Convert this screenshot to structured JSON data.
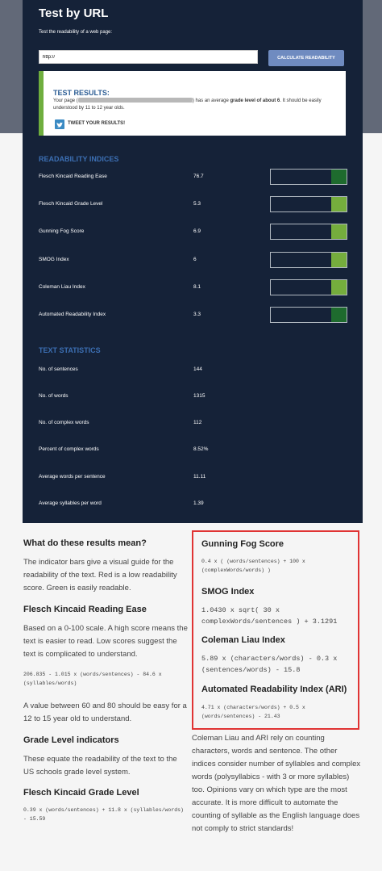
{
  "header": {
    "title": "Test by URL",
    "subtitle": "Test the readability of a web page:"
  },
  "url_input": {
    "value": "http://"
  },
  "calc_button": "CALCULATE READABILITY",
  "results": {
    "title": "TEST RESULTS:",
    "text_prefix": "Your page (",
    "text_mid": ") has an average ",
    "text_bold": "grade level of about 6",
    "text_suffix": ". It should be easily understood by 11 to 12 year olds.",
    "tweet": "TWEET YOUR RESULTS!"
  },
  "indices": {
    "heading": "READABILITY INDICES",
    "rows": [
      {
        "label": "Flesch Kincaid Reading Ease",
        "value": "76.7",
        "fill": 0.2,
        "color": "#1e6b2e"
      },
      {
        "label": "Flesch Kincaid Grade Level",
        "value": "5.3",
        "fill": 0.2,
        "color": "#75ad3d"
      },
      {
        "label": "Gunning Fog Score",
        "value": "6.9",
        "fill": 0.2,
        "color": "#75ad3d"
      },
      {
        "label": "SMOG Index",
        "value": "6",
        "fill": 0.2,
        "color": "#75ad3d"
      },
      {
        "label": "Coleman Liau Index",
        "value": "8.1",
        "fill": 0.2,
        "color": "#75ad3d"
      },
      {
        "label": "Automated Readability Index",
        "value": "3.3",
        "fill": 0.2,
        "color": "#1e6b2e"
      }
    ]
  },
  "stats": {
    "heading": "TEXT STATISTICS",
    "rows": [
      {
        "label": "No. of sentences",
        "value": "144"
      },
      {
        "label": "No. of words",
        "value": "1315"
      },
      {
        "label": "No. of complex words",
        "value": "112"
      },
      {
        "label": "Percent of complex words",
        "value": "8.52%"
      },
      {
        "label": "Average words per sentence",
        "value": "11.11"
      },
      {
        "label": "Average syllables per word",
        "value": "1.39"
      }
    ]
  },
  "left": {
    "h1": "What do these results mean?",
    "p1": "The indicator bars give a visual guide for the readability of the text. Red is a low readability score. Green is easily readable.",
    "h2": "Flesch Kincaid Reading Ease",
    "p2": "Based on a 0-100 scale. A high score means the text is easier to read. Low scores suggest the text is complicated to understand.",
    "f2": "206.835 - 1.015 x (words/sentences) - 84.6 x (syllables/words)",
    "p3": "A value between 60 and 80 should be easy for a 12 to 15 year old to understand.",
    "h3": "Grade Level indicators",
    "p4": "These equate the readability of the text to the US schools grade level system.",
    "h4": "Flesch Kincaid Grade Level",
    "f4": "0.39 x (words/sentences) + 11.8 x (syllables/words) - 15.59"
  },
  "right": {
    "h1": "Gunning Fog Score",
    "f1": "0.4 x ( (words/sentences) + 100 x (complexWords/words) )",
    "h2": "SMOG Index",
    "f2": "1.0430 x sqrt( 30 x complexWords/sentences ) + 3.1291",
    "h3": "Coleman Liau Index",
    "f3": "5.89 x (characters/words) - 0.3 x (sentences/words) - 15.8",
    "h4": "Automated Readability Index (ARI)",
    "f4": "4.71 x (characters/words) + 0.5 x (words/sentences) - 21.43",
    "p1": "Coleman Liau and ARI rely on counting characters, words and sentence. The other indices consider number of syllables and complex words (polysyllabics - with 3 or more syllables) too. Opinions vary on which type are the most accurate. It is more difficult to automate the counting of syllable as the English language does not comply to strict standards!"
  }
}
